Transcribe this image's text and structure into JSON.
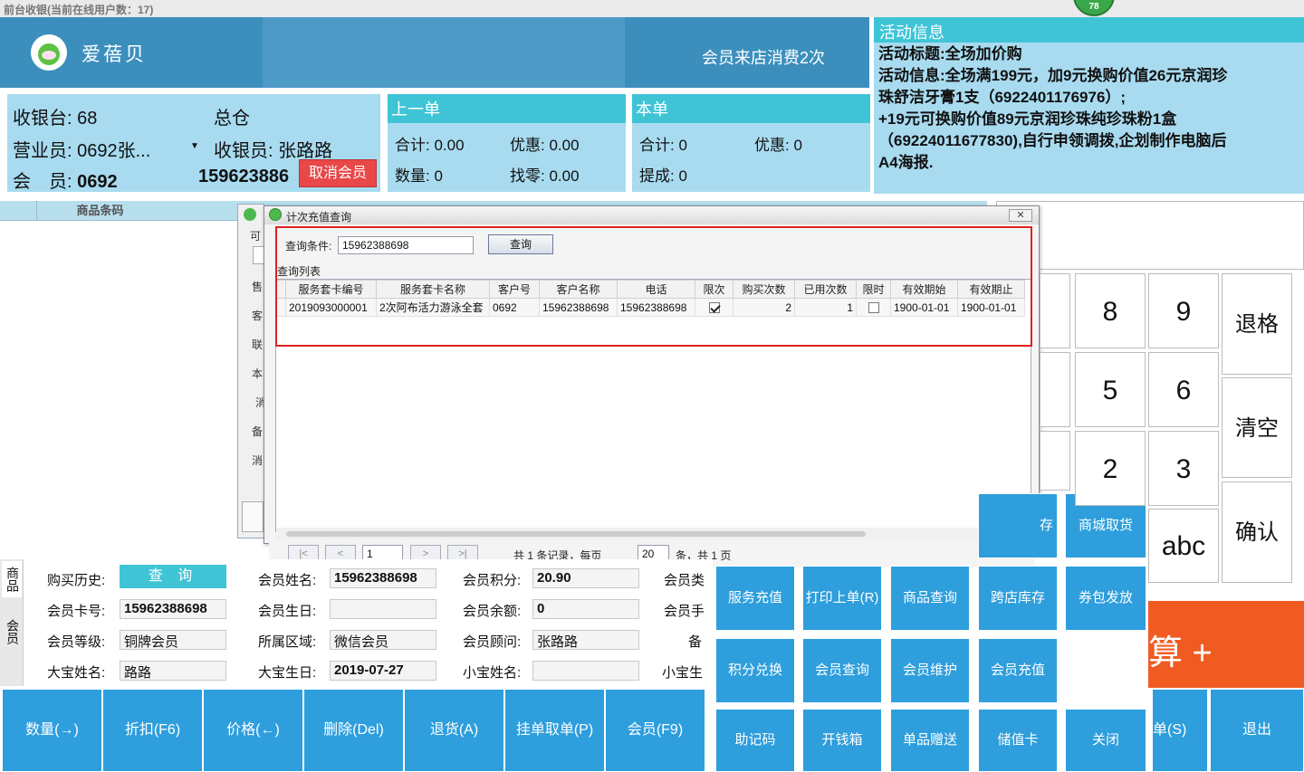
{
  "window": {
    "title": "前台收银(当前在线用户数：17)",
    "badge": "78"
  },
  "header": {
    "brand": "爱蓓贝",
    "visit_text": "会员来店消费2次"
  },
  "activity": {
    "title": "活动信息",
    "lines": [
      "活动标题:全场加价购",
      "活动信息:全场满199元，加9元换购价值26元京润珍",
      "珠舒洁牙膏1支（6922401176976）;",
      "+19元可换购价值89元京润珍珠纯珍珠粉1盒",
      "（69224011677830),自行申领调拨,企划制作电脑后",
      "A4海报."
    ]
  },
  "cashier": {
    "register_label": "收银台: ",
    "register_value": "68",
    "warehouse": "总仓",
    "clerk_label": "营业员: ",
    "clerk_value": "0692张...",
    "cashier_label": "收银员: ",
    "cashier_value": "张路路",
    "member_label": "会　员: ",
    "member_value": "0692",
    "member_phone": "159623886",
    "cancel_member": "取消会员"
  },
  "last_order": {
    "title": "上一单",
    "total_label": "合计: ",
    "total": "0.00",
    "discount_label": "优惠: ",
    "discount": "0.00",
    "qty_label": "数量: ",
    "qty": "0",
    "change_label": "找零: ",
    "change": "0.00"
  },
  "this_order": {
    "title": "本单",
    "total_label": "合计: ",
    "total": "0",
    "discount_label": "优惠: ",
    "discount": "0",
    "commission_label": "提成: ",
    "commission": "0"
  },
  "grid": {
    "column_barcode": "商品条码"
  },
  "back_dialog": {
    "labels": [
      "可",
      "售",
      "客",
      "联",
      "本",
      "消",
      "备",
      "消"
    ]
  },
  "dialog": {
    "title": "计次充值查询",
    "close": "✕",
    "query_label": "查询条件:",
    "query_value": "15962388698",
    "query_button": "查询",
    "list_label": "查询列表",
    "columns": [
      "服务套卡编号",
      "服务套卡名称",
      "客户号",
      "客户名称",
      "电话",
      "限次",
      "购买次数",
      "已用次数",
      "限时",
      "有效期始",
      "有效期止"
    ],
    "rows": [
      {
        "card_no": "2019093000001",
        "card_name": "2次阿布活力游泳全套",
        "customer_no": "0692",
        "customer_name": "15962388698",
        "phone": "15962388698",
        "limit_times": true,
        "bought": "2",
        "used": "1",
        "limit_time": false,
        "start": "1900-01-01",
        "end": "1900-01-01"
      }
    ],
    "pager": {
      "first": "|<",
      "prev": "<",
      "page": "1",
      "next": ">",
      "last": ">|",
      "summary_a": "共 1 条记录，每页",
      "page_size": "20",
      "summary_b": "条，共 1 页"
    }
  },
  "member": {
    "tabs": [
      "商品",
      "会员"
    ],
    "history_label": "购买历史:",
    "history_button": "查 询",
    "name_label": "会员姓名:",
    "name": "15962388698",
    "points_label": "会员积分:",
    "points": "20.90",
    "type_label": "会员类",
    "card_label": "会员卡号:",
    "card": "15962388698",
    "birthday_label": "会员生日:",
    "birthday": "",
    "balance_label": "会员余额:",
    "balance": "0",
    "phone_label": "会员手",
    "level_label": "会员等级:",
    "level": "铜牌会员",
    "region_label": "所属区域:",
    "region": "微信会员",
    "advisor_label": "会员顾问:",
    "advisor": "张路路",
    "note_label": "备",
    "child1_name_label": "大宝姓名:",
    "child1_name": "路路",
    "child1_bday_label": "大宝生日:",
    "child1_bday": "2019-07-27",
    "child2_name_label": "小宝姓名:",
    "child2_name": "",
    "child2_bday_label": "小宝生"
  },
  "bottom_buttons": [
    "数量(→)",
    "折扣(F6)",
    "价格(←)",
    "删除(Del)",
    "退货(A)",
    "挂单取单(P)",
    "会员(F9)"
  ],
  "function_buttons": {
    "row0": [
      "商城取货"
    ],
    "row1": [
      "服务充值",
      "打印上单(R)",
      "商品查询",
      "跨店库存",
      "券包发放"
    ],
    "row2": [
      "积分兑换",
      "会员查询",
      "会员维护",
      "会员充值"
    ],
    "row3": [
      "助记码",
      "开钱箱",
      "单品赠送",
      "储值卡",
      "关闭"
    ],
    "partial": "存"
  },
  "numpad": {
    "keys": [
      "8",
      "9",
      "5",
      "6",
      "2",
      "3",
      "abc"
    ],
    "backspace": "退格",
    "clear": "清空",
    "confirm": "确认",
    "settle": "算 +",
    "bottom_partial": "单(S)",
    "exit": "退出"
  }
}
